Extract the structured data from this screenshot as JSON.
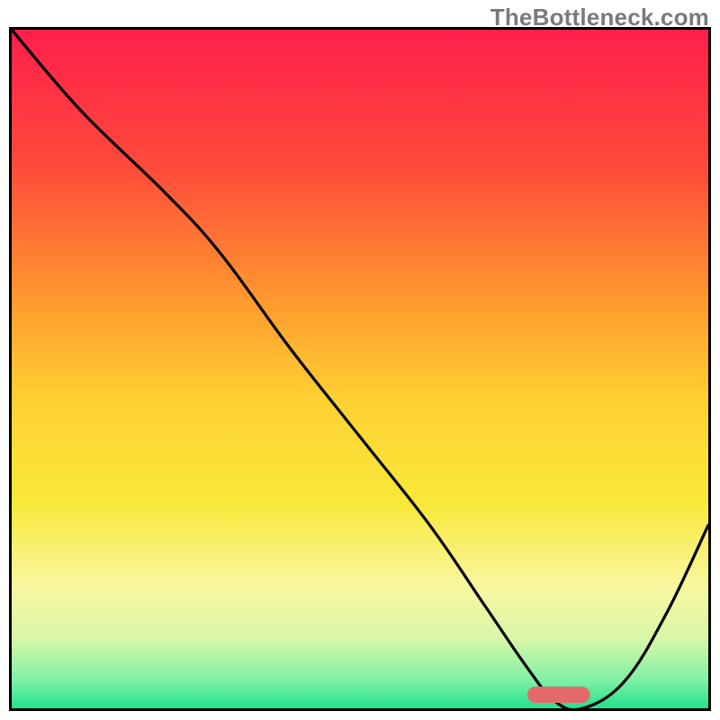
{
  "watermark": "TheBottleneck.com",
  "chart_data": {
    "type": "line",
    "title": "",
    "xlabel": "",
    "ylabel": "",
    "xlim": [
      0,
      100
    ],
    "ylim": [
      0,
      100
    ],
    "grid": false,
    "legend": false,
    "background": {
      "type": "vertical_gradient",
      "stops": [
        {
          "pos": 0.0,
          "color": "#ff1f4b"
        },
        {
          "pos": 0.2,
          "color": "#ff4a3b"
        },
        {
          "pos": 0.4,
          "color": "#ff9a2e"
        },
        {
          "pos": 0.55,
          "color": "#ffd233"
        },
        {
          "pos": 0.7,
          "color": "#f7e93a"
        },
        {
          "pos": 0.82,
          "color": "#f9f7a0"
        },
        {
          "pos": 0.9,
          "color": "#d6f7a8"
        },
        {
          "pos": 0.96,
          "color": "#7cf0a5"
        },
        {
          "pos": 1.0,
          "color": "#22e28b"
        }
      ]
    },
    "series": [
      {
        "name": "bottleneck-curve",
        "color": "#000000",
        "x": [
          0,
          10,
          22,
          30,
          40,
          50,
          60,
          68,
          74,
          78,
          82,
          88,
          94,
          100
        ],
        "y": [
          100,
          88,
          76,
          67,
          53,
          40,
          27,
          15,
          6,
          1,
          0,
          4,
          14,
          27
        ]
      }
    ],
    "marker": {
      "name": "optimal-range",
      "shape": "rounded-bar",
      "color": "#e46a6a",
      "x_start": 74,
      "x_end": 83,
      "y": 0.8,
      "height": 2.4
    }
  }
}
